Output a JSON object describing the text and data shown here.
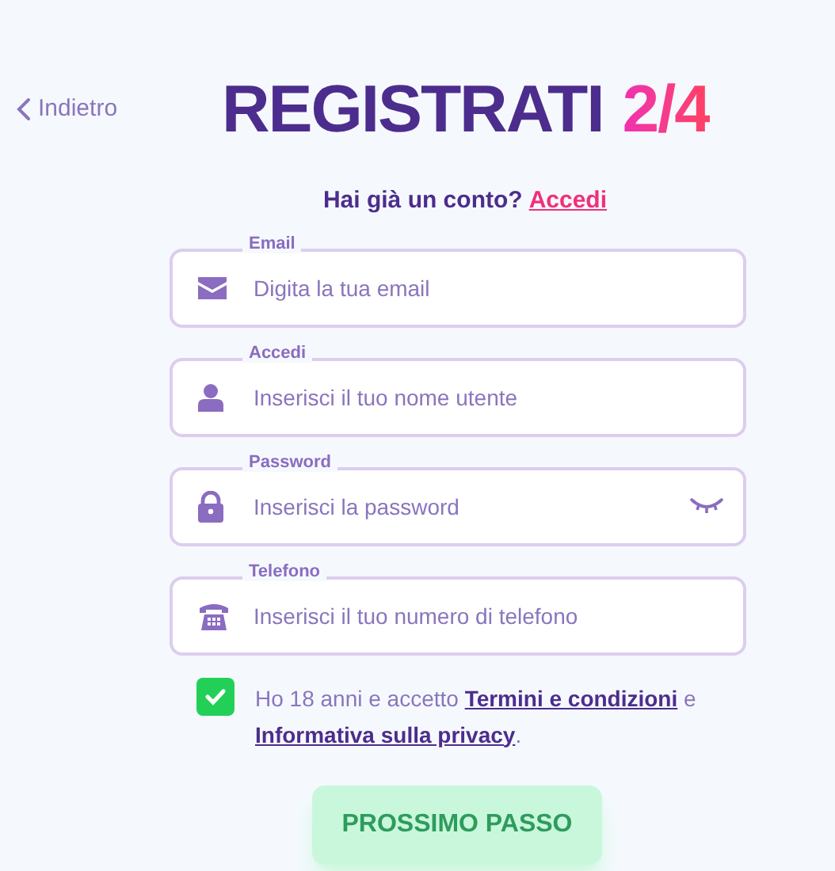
{
  "back_link": {
    "label": "Indietro"
  },
  "title": {
    "text": "REGISTRATI",
    "step": "2/4"
  },
  "login_prompt": {
    "text": "Hai già un conto?",
    "link": "Accedi"
  },
  "fields": [
    {
      "label": "Email",
      "placeholder": "Digita la tua email",
      "kind": "email",
      "reveal_toggle": false
    },
    {
      "label": "Accedi",
      "placeholder": "Inserisci il tuo nome utente",
      "kind": "user",
      "reveal_toggle": false
    },
    {
      "label": "Password",
      "placeholder": "Inserisci la password",
      "kind": "lock",
      "reveal_toggle": true
    },
    {
      "label": "Telefono",
      "placeholder": "Inserisci il tuo numero di telefono",
      "kind": "phone",
      "reveal_toggle": false
    }
  ],
  "consent": {
    "checked": true,
    "parts": [
      {
        "text": "Ho 18 anni e accetto ",
        "link": false
      },
      {
        "text": "Termini e condizioni",
        "link": true
      },
      {
        "text": " e ",
        "link": false
      },
      {
        "text": "Informativa sulla privacy",
        "link": true
      },
      {
        "text": ".",
        "link": false
      }
    ]
  },
  "next_button": {
    "label": "PROSSIMO PASSO",
    "disabled": true
  }
}
